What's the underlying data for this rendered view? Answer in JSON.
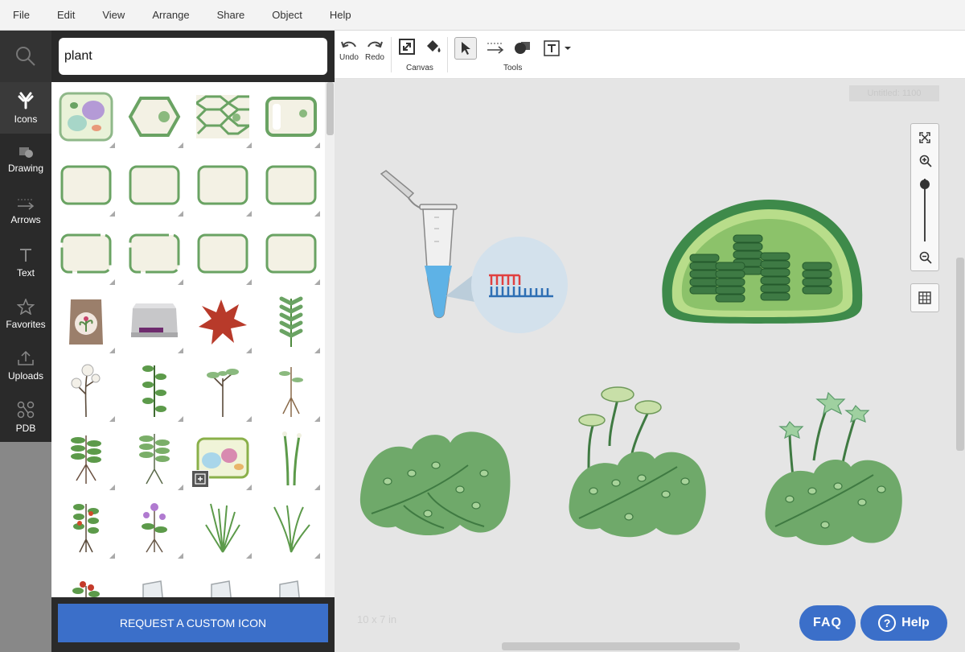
{
  "menu": [
    "File",
    "Edit",
    "View",
    "Arrange",
    "Share",
    "Object",
    "Help"
  ],
  "sidebar": {
    "items": [
      {
        "label": "Icons",
        "icon": "antibody-icon"
      },
      {
        "label": "Drawing",
        "icon": "shapes-icon"
      },
      {
        "label": "Arrows",
        "icon": "arrow-icon"
      },
      {
        "label": "Text",
        "icon": "text-icon"
      },
      {
        "label": "Favorites",
        "icon": "star-icon"
      },
      {
        "label": "Uploads",
        "icon": "upload-icon"
      },
      {
        "label": "PDB",
        "icon": "molecule-icon"
      }
    ]
  },
  "search": {
    "value": "plant"
  },
  "icon_grid": [
    "plant-cell-icon",
    "hexagon-cell-icon",
    "cell-wall-tiles-icon",
    "rounded-cell-icon",
    "cell-frame-icon",
    "cell-frame-icon",
    "cell-frame-icon",
    "cell-frame-icon",
    "cell-frame-dashed-icon",
    "cell-frame-dashed-icon",
    "cell-frame-icon",
    "cell-frame-icon",
    "seed-bag-icon",
    "incubator-icon",
    "dendritic-cell-icon",
    "fern-icon",
    "cotton-plant-icon",
    "vine-plant-icon",
    "sapling-icon",
    "seedling-roots-icon",
    "plant-with-roots-icon",
    "young-plant-icon",
    "plant-cell-detailed-icon",
    "grass-shoot-icon",
    "tomato-plant-icon",
    "flowering-plant-icon",
    "grass-tuft-icon",
    "grass-icon",
    "berry-plant-icon",
    "glass-slide-icon",
    "glass-slide-icon",
    "glass-slide-icon"
  ],
  "request_button": "REQUEST A CUSTOM ICON",
  "toolbar": {
    "undo": "Undo",
    "redo": "Redo",
    "canvas_group": "Canvas",
    "tools_group": "Tools"
  },
  "canvas": {
    "size_label": "10 x 7 in",
    "ghost_label": "Untitled: 1100"
  },
  "buttons": {
    "faq": "FAQ",
    "help": "Help"
  },
  "colors": {
    "accent": "#3b6fc9",
    "leaf": "#6fa96a",
    "chloroplast": "#4a8a4e"
  }
}
